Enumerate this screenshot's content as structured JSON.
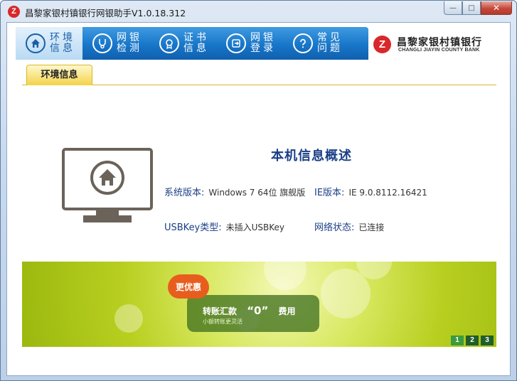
{
  "window": {
    "title": "昌黎家银村镇银行网银助手V1.0.18.312",
    "app_icon": "Z",
    "buttons": {
      "minimize": "—",
      "maximize": "□",
      "close": "✕"
    }
  },
  "nav": {
    "items": [
      {
        "label": "环境信息",
        "icon": "home-icon",
        "active": true
      },
      {
        "label": "网银检测",
        "icon": "stethoscope-icon",
        "active": false
      },
      {
        "label": "证书信息",
        "icon": "certificate-icon",
        "active": false
      },
      {
        "label": "网银登录",
        "icon": "login-icon",
        "active": false
      },
      {
        "label": "常见问题",
        "icon": "question-icon",
        "active": false
      }
    ]
  },
  "bank": {
    "mark": "Z",
    "name_cn": "昌黎家银村镇银行",
    "name_en": "CHANGLI JIAYIN COUNTY BANK"
  },
  "tab": {
    "label": "环境信息"
  },
  "info": {
    "title": "本机信息概述",
    "os_label": "系统版本:",
    "os_value": "Windows 7 64位 旗舰版",
    "ie_label": "IE版本:",
    "ie_value": "IE 9.0.8112.16421",
    "usbkey_label": "USBKey类型:",
    "usbkey_value": "未插入USBKey",
    "net_label": "网络状态:",
    "net_value": "已连接"
  },
  "banner": {
    "badge": "更优惠",
    "main_left": "转账汇款",
    "main_mark": "“0”",
    "main_right": "费用",
    "sub": "小额转账更灵活",
    "pages": [
      "1",
      "2",
      "3"
    ],
    "active_page": "1"
  },
  "colors": {
    "nav_blue": "#1876c9",
    "title_blue": "#1a3f86",
    "brand_red": "#d8282a",
    "tab_yellow": "#f3d34a",
    "banner_green": "#b8cf20"
  }
}
